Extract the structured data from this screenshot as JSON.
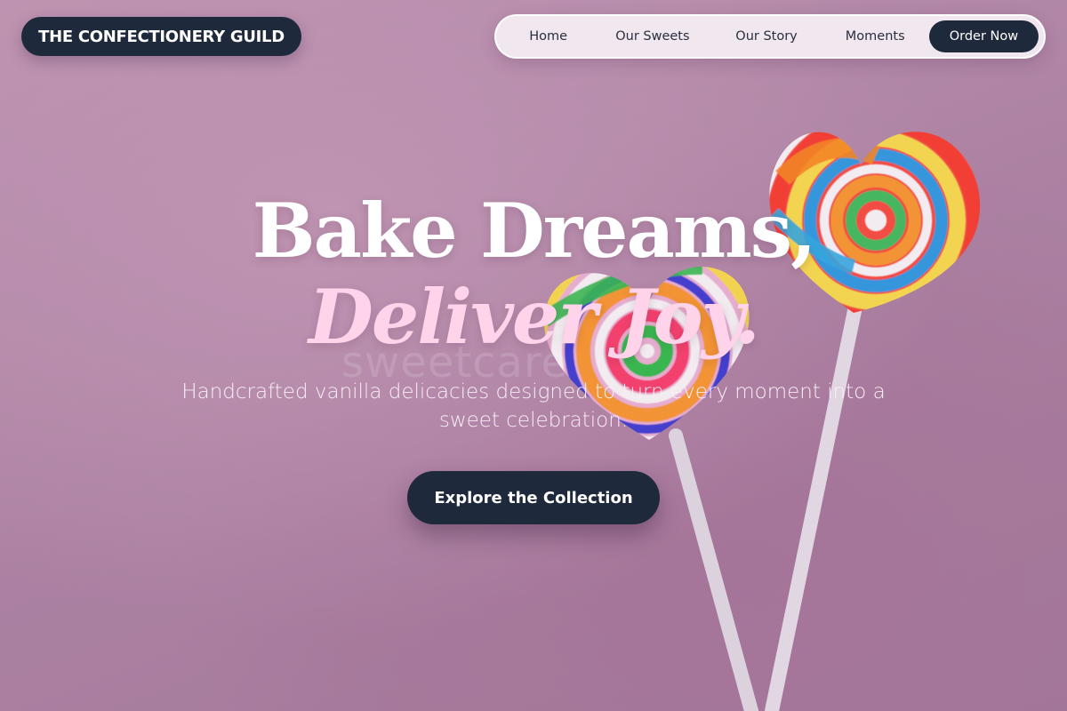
{
  "brand": {
    "name": "THE CONFECTIONERY GUILD"
  },
  "nav": {
    "items": [
      {
        "label": "Home"
      },
      {
        "label": "Our Sweets"
      },
      {
        "label": "Our Story"
      },
      {
        "label": "Moments"
      }
    ],
    "cta_label": "Order Now"
  },
  "hero": {
    "headline_line1": "Bake Dreams,",
    "headline_line2": "Deliver Joy.",
    "subtitle": "Handcrafted vanilla delicacies designed to turn every moment into a sweet celebration.",
    "cta_label": "Explore the Collection",
    "watermark": "sweetcare"
  },
  "colors": {
    "dark_navy": "#1e2a3c",
    "pink_accent": "#ffd3ea",
    "background_mauve": "#b58aa8"
  }
}
